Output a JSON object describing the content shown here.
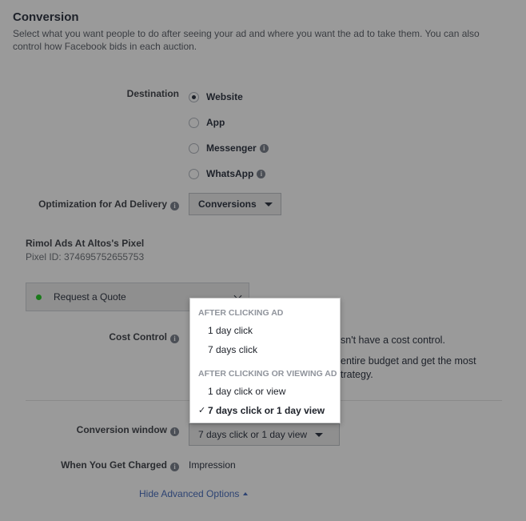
{
  "section": {
    "title": "Conversion",
    "description": "Select what you want people to do after seeing your ad and where you want the ad to take them. You can also control how Facebook bids in each auction."
  },
  "destination": {
    "label": "Destination",
    "options": [
      {
        "label": "Website",
        "selected": true
      },
      {
        "label": "App",
        "selected": false
      },
      {
        "label": "Messenger",
        "selected": false
      },
      {
        "label": "WhatsApp",
        "selected": false
      }
    ]
  },
  "optimization": {
    "label": "Optimization for Ad Delivery",
    "value": "Conversions"
  },
  "pixel": {
    "name": "Rimol Ads At Altos's Pixel",
    "id_text": "Pixel ID: 374695752655753"
  },
  "conversion_event": {
    "value": "Request a Quote"
  },
  "cost_control": {
    "label": "Cost Control",
    "line1_partial": "sn't have a cost control.",
    "line2_partial": "entire budget and get the most",
    "line3_partial": "trategy."
  },
  "conversion_window": {
    "label": "Conversion window",
    "value": "7 days click or 1 day view"
  },
  "charged": {
    "label": "When You Get Charged",
    "value": "Impression"
  },
  "advanced_link": "Hide Advanced Options",
  "popup": {
    "header1": "AFTER CLICKING AD",
    "items1": [
      "1 day click",
      "7 days click"
    ],
    "header2": "AFTER CLICKING OR VIEWING AD",
    "items2": [
      "1 day click or view",
      "7 days click or 1 day view"
    ],
    "check_mark": "✓"
  },
  "colors": {
    "overlay_bg": "#9a9a9a",
    "link": "#2d4373",
    "pixel_status": "#1a7a1a"
  }
}
